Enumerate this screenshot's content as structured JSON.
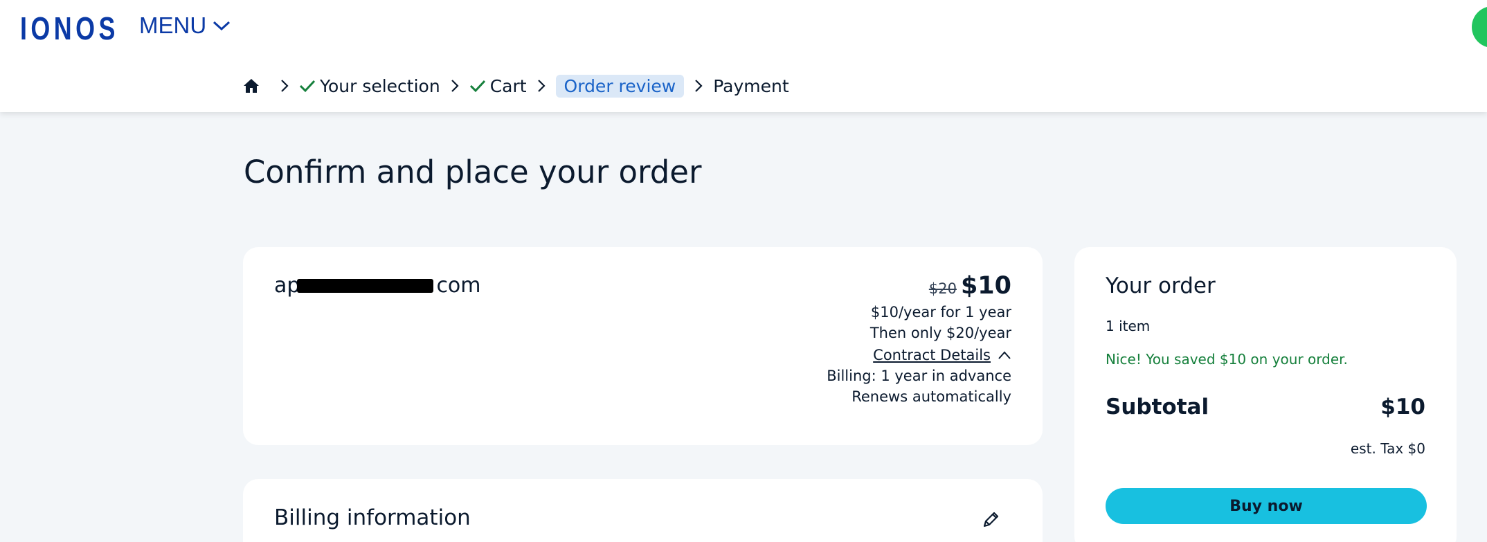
{
  "header": {
    "logo_text": "IONOS",
    "menu_label": "MENU",
    "brand_color": "#0b3aa6",
    "avatar_color": "#22c55e"
  },
  "breadcrumb": {
    "items": [
      {
        "label": "Your selection",
        "done": true
      },
      {
        "label": "Cart",
        "done": true
      },
      {
        "label": "Order review",
        "active": true
      },
      {
        "label": "Payment"
      }
    ],
    "icons": [
      "home-icon",
      "chevron-right-icon",
      "check-icon"
    ]
  },
  "page": {
    "title": "Confirm and place your order"
  },
  "domain_card": {
    "name_prefix": "ap",
    "name_suffix": "com",
    "old_price": "$20",
    "new_price": "$10",
    "price_line_1": "$10/year for 1 year",
    "price_line_2": "Then only $20/year",
    "contract_details_label": "Contract Details",
    "billing_term": "Billing: 1 year in advance",
    "renewal": "Renews automatically"
  },
  "billing_card": {
    "title": "Billing information",
    "edit_icon": "pencil-icon"
  },
  "order_summary": {
    "title": "Your order",
    "item_count": "1 item",
    "savings_message": "Nice! You saved $10 on your order.",
    "subtotal_label": "Subtotal",
    "subtotal_value": "$10",
    "tax": "est. Tax $0",
    "buy_button": "Buy now",
    "button_color": "#18c0e0",
    "savings_color": "#16803c"
  }
}
